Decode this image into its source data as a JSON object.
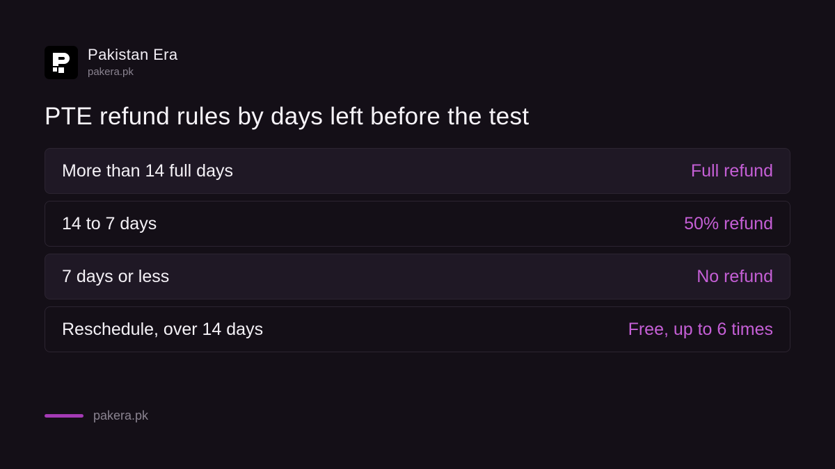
{
  "brand": {
    "name": "Pakistan Era",
    "url": "pakera.pk",
    "logo_icon": "brand-logo-p-icon"
  },
  "title": "PTE refund rules by days left before the test",
  "rows": [
    {
      "label": "More than 14 full days",
      "value": "Full refund",
      "shaded": true
    },
    {
      "label": "14 to 7 days",
      "value": "50% refund",
      "shaded": false
    },
    {
      "label": "7 days or less",
      "value": "No refund",
      "shaded": true
    },
    {
      "label": "Reschedule, over 14 days",
      "value": "Free, up to 6 times",
      "shaded": false
    }
  ],
  "footer": {
    "url": "pakera.pk"
  },
  "colors": {
    "background": "#140f17",
    "accent": "#c55fd6",
    "accent_bar": "#a43ab5",
    "muted": "#8a8390"
  }
}
